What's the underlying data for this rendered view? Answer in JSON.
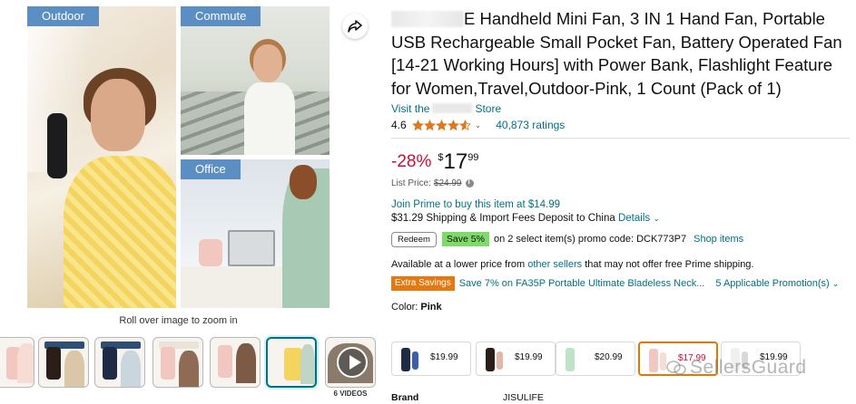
{
  "gallery": {
    "tags": {
      "outdoor": "Outdoor",
      "commute": "Commute",
      "office": "Office"
    },
    "roll_over": "Roll over image to zoom in",
    "videos_label": "6 VIDEOS"
  },
  "product": {
    "title": "E Handheld Mini Fan, 3 IN 1 Hand Fan, Portable USB Rechargeable Small Pocket Fan, Battery Operated Fan [14-21 Working Hours] with Power Bank, Flashlight Feature for Women,Travel,Outdoor-Pink, 1 Count (Pack of 1)",
    "store_prefix": "Visit the",
    "store_suffix": "Store",
    "rating": "4.6",
    "rating_value": 4.6,
    "ratings_count": "40,873 ratings",
    "discount": "-28%",
    "price_symbol": "$",
    "price_whole": "17",
    "price_fraction": "99",
    "list_price_label": "List Price:",
    "list_price": "$24.99",
    "prime_text": "Join Prime to buy this item at $14.99",
    "shipping_text": "$31.29 Shipping & Import Fees Deposit to China",
    "shipping_details": "Details",
    "redeem": "Redeem",
    "save_badge": "Save 5%",
    "promo_text": "on 2 select item(s) promo code: DCK773P7",
    "shop_items": "Shop items",
    "avail_prefix": "Available at a lower price from",
    "avail_link": "other sellers",
    "avail_suffix": "that may not offer free Prime shipping.",
    "extra_badge": "Extra Savings",
    "extra_text": "Save 7% on FA35P Portable Ultimate Bladeless Neck...",
    "applicable": "5 Applicable Promotion(s)",
    "color_label": "Color:",
    "color_value": "Pink",
    "swatches": [
      {
        "price": "$19.99",
        "color": "#1f2a44",
        "accent": "#3c5fa8"
      },
      {
        "price": "$19.99",
        "color": "#2b1d17",
        "accent": "#e0b8a8"
      },
      {
        "price": "$20.99",
        "color": "#bfe3c7",
        "accent": "#ffffff"
      },
      {
        "price": "$17.99",
        "color": "#f2c7c0",
        "accent": "#f7dcd6"
      },
      {
        "price": "$19.99",
        "color": "#f0f0f0",
        "accent": "#d9d9d9"
      }
    ],
    "brand_label": "Brand",
    "brand_value": "JISULIFE"
  },
  "watermark": "SellersGuard",
  "colors": {
    "link": "#007185",
    "discount": "#cc0c39",
    "star": "#de7921",
    "badge_green": "#7fda69",
    "extra_orange": "#e47911",
    "tag_blue": "#5b8fc3"
  }
}
